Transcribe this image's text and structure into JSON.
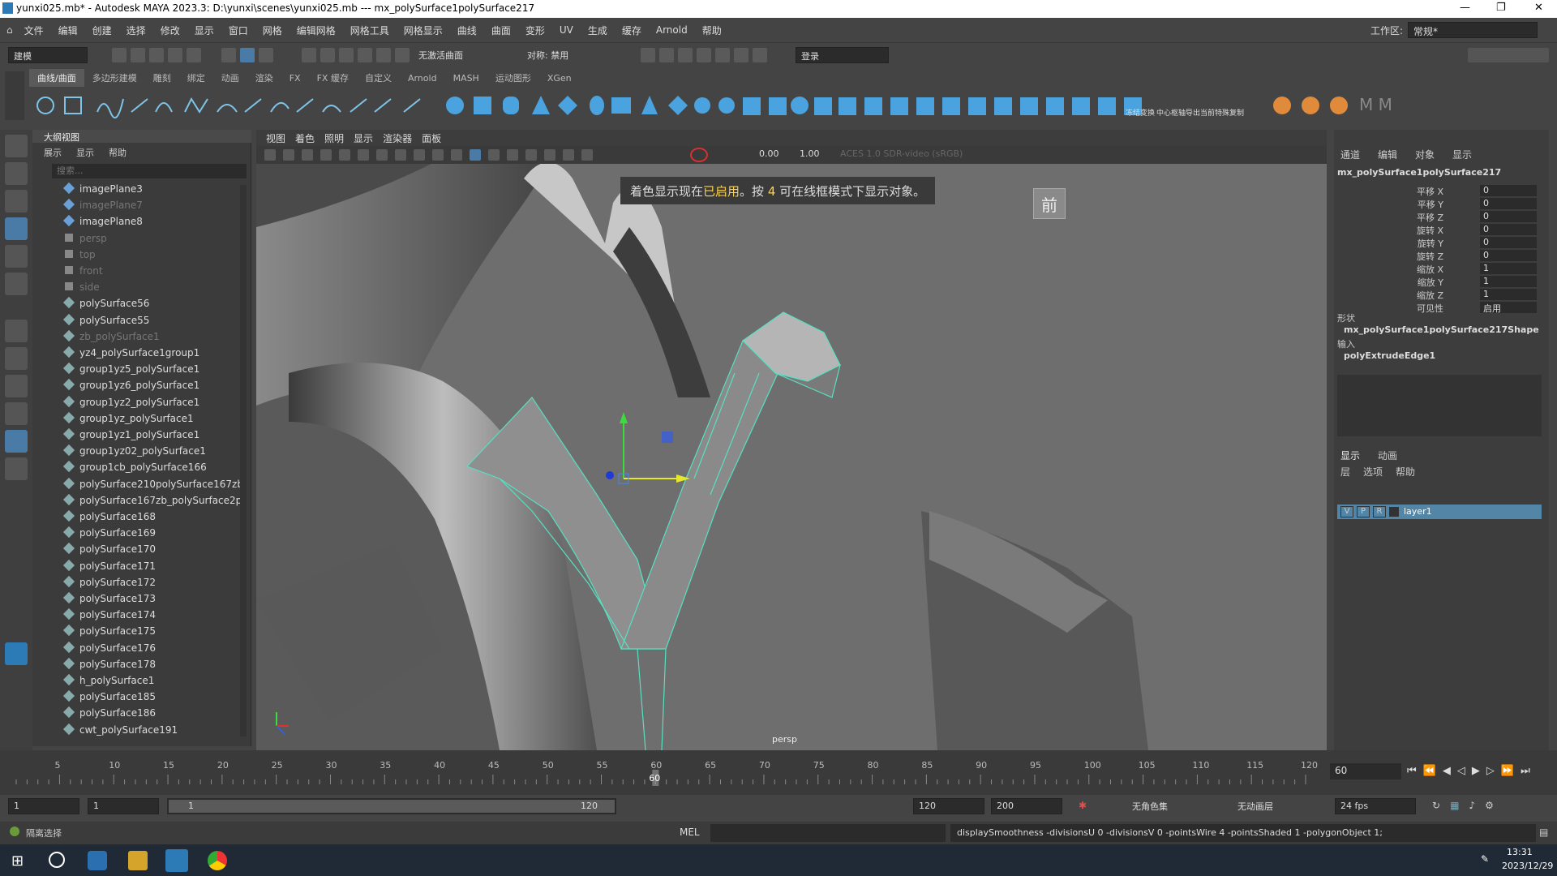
{
  "titlebar": {
    "text": "yunxi025.mb* - Autodesk MAYA 2023.3: D:\\yunxi\\scenes\\yunxi025.mb  ---  mx_polySurface1polySurface217",
    "min": "—",
    "max": "❐",
    "close": "✕"
  },
  "menu": [
    "文件",
    "编辑",
    "创建",
    "选择",
    "修改",
    "显示",
    "窗口",
    "网格",
    "编辑网格",
    "网格工具",
    "网格显示",
    "曲线",
    "曲面",
    "变形",
    "UV",
    "生成",
    "缓存",
    "Arnold",
    "帮助"
  ],
  "workspace_label": "工作区:",
  "workspace_value": "常规*",
  "status": {
    "mode": "建模",
    "live_surface": "无激活曲面",
    "symmetry": "对称: 禁用",
    "login": "登录"
  },
  "shelf_tabs": [
    "曲线/曲面",
    "多边形建模",
    "雕刻",
    "绑定",
    "动画",
    "渲染",
    "FX",
    "FX 缓存",
    "自定义",
    "Arnold",
    "MASH",
    "运动图形",
    "XGen"
  ],
  "shelf_labels": [
    "冻结变换",
    "中心枢轴",
    "导出当前",
    "特殊复制"
  ],
  "outliner": {
    "title": "大纲视图",
    "menu": [
      "展示",
      "显示",
      "帮助"
    ],
    "search_placeholder": "搜索...",
    "items": [
      {
        "name": "imagePlane3",
        "dim": false
      },
      {
        "name": "imagePlane7",
        "dim": true
      },
      {
        "name": "imagePlane8",
        "dim": false
      },
      {
        "name": "persp",
        "dim": true
      },
      {
        "name": "top",
        "dim": true
      },
      {
        "name": "front",
        "dim": true
      },
      {
        "name": "side",
        "dim": true
      },
      {
        "name": "polySurface56",
        "dim": false
      },
      {
        "name": "polySurface55",
        "dim": false
      },
      {
        "name": "zb_polySurface1",
        "dim": true
      },
      {
        "name": "yz4_polySurface1group1",
        "dim": false
      },
      {
        "name": "group1yz5_polySurface1",
        "dim": false
      },
      {
        "name": "group1yz6_polySurface1",
        "dim": false
      },
      {
        "name": "group1yz2_polySurface1",
        "dim": false
      },
      {
        "name": "group1yz_polySurface1",
        "dim": false
      },
      {
        "name": "group1yz1_polySurface1",
        "dim": false
      },
      {
        "name": "group1yz02_polySurface1",
        "dim": false
      },
      {
        "name": "group1cb_polySurface166",
        "dim": false
      },
      {
        "name": "polySurface210polySurface167zb",
        "dim": false
      },
      {
        "name": "polySurface167zb_polySurface2p",
        "dim": false
      },
      {
        "name": "polySurface168",
        "dim": false
      },
      {
        "name": "polySurface169",
        "dim": false
      },
      {
        "name": "polySurface170",
        "dim": false
      },
      {
        "name": "polySurface171",
        "dim": false
      },
      {
        "name": "polySurface172",
        "dim": false
      },
      {
        "name": "polySurface173",
        "dim": false
      },
      {
        "name": "polySurface174",
        "dim": false
      },
      {
        "name": "polySurface175",
        "dim": false
      },
      {
        "name": "polySurface176",
        "dim": false
      },
      {
        "name": "polySurface178",
        "dim": false
      },
      {
        "name": "h_polySurface1",
        "dim": false
      },
      {
        "name": "polySurface185",
        "dim": false
      },
      {
        "name": "polySurface186",
        "dim": false
      },
      {
        "name": "cwt_polySurface191",
        "dim": false
      }
    ]
  },
  "viewport": {
    "menu": [
      "视图",
      "着色",
      "照明",
      "显示",
      "渲染器",
      "面板"
    ],
    "exposure": "0.00",
    "gamma": "1.00",
    "colorspace": "ACES 1.0 SDR-video (sRGB)",
    "message_a": "着色显示现在",
    "message_b": "已启用",
    "message_c": "。按",
    "message_d": "4",
    "message_e": "可在线框模式下显示对象。",
    "view_label": "前",
    "camera": "persp"
  },
  "channelbox": {
    "menu": [
      "通道",
      "编辑",
      "对象",
      "显示"
    ],
    "object": "mx_polySurface1polySurface217",
    "channels": [
      {
        "l": "平移 X",
        "v": "0"
      },
      {
        "l": "平移 Y",
        "v": "0"
      },
      {
        "l": "平移 Z",
        "v": "0"
      },
      {
        "l": "旋转 X",
        "v": "0"
      },
      {
        "l": "旋转 Y",
        "v": "0"
      },
      {
        "l": "旋转 Z",
        "v": "0"
      },
      {
        "l": "缩放 X",
        "v": "1"
      },
      {
        "l": "缩放 Y",
        "v": "1"
      },
      {
        "l": "缩放 Z",
        "v": "1"
      },
      {
        "l": "可见性",
        "v": "启用"
      }
    ],
    "shape_header": "形状",
    "shape": "mx_polySurface1polySurface217Shape",
    "input_header": "输入",
    "input": "polyExtrudeEdge1"
  },
  "layers": {
    "tabs": [
      "显示",
      "动画"
    ],
    "menu": [
      "层",
      "选项",
      "帮助"
    ],
    "v": "V",
    "p": "P",
    "r": "R",
    "layer": "layer1"
  },
  "timeline": {
    "ticks": [
      "5",
      "10",
      "15",
      "20",
      "25",
      "30",
      "35",
      "40",
      "45",
      "50",
      "55",
      "60",
      "65",
      "70",
      "75",
      "80",
      "85",
      "90",
      "95",
      "100",
      "105",
      "110",
      "115",
      "120"
    ],
    "current": "60",
    "current_field": "60"
  },
  "range": {
    "start": "1",
    "start2": "1",
    "slider_start": "1",
    "slider_end": "120",
    "end": "120",
    "end2": "200",
    "charset": "无角色集",
    "anim_layer": "无动画层",
    "fps": "24 fps"
  },
  "cmd": {
    "status": "隔离选择",
    "lang": "MEL",
    "output": "displaySmoothness -divisionsU 0 -divisionsV 0 -pointsWire 4 -pointsShaded 1 -polygonObject 1;"
  },
  "taskbar": {
    "time": "13:31",
    "date": "2023/12/29"
  }
}
